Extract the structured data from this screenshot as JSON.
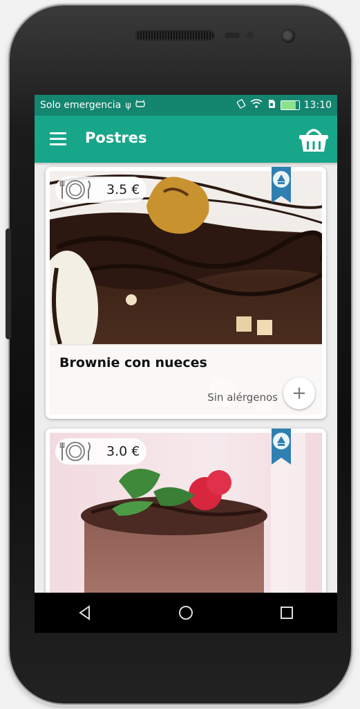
{
  "status_bar": {
    "carrier": "Solo emergencia",
    "usb_icon": "usb-icon",
    "android_icon": "android-debug-icon",
    "time": "13:10"
  },
  "app_bar": {
    "title": "Postres",
    "menu_icon": "hamburger-menu-icon",
    "basket_icon": "shopping-basket-icon",
    "color": "#18a68a"
  },
  "products": [
    {
      "name": "Brownie con nueces",
      "price": "3.5 €",
      "allergens": "Sin alérgenos",
      "add_label": "+"
    },
    {
      "name": "",
      "price": "3.0 €"
    }
  ],
  "nav": {
    "back": "back-icon",
    "home": "home-icon",
    "recents": "recents-icon"
  }
}
